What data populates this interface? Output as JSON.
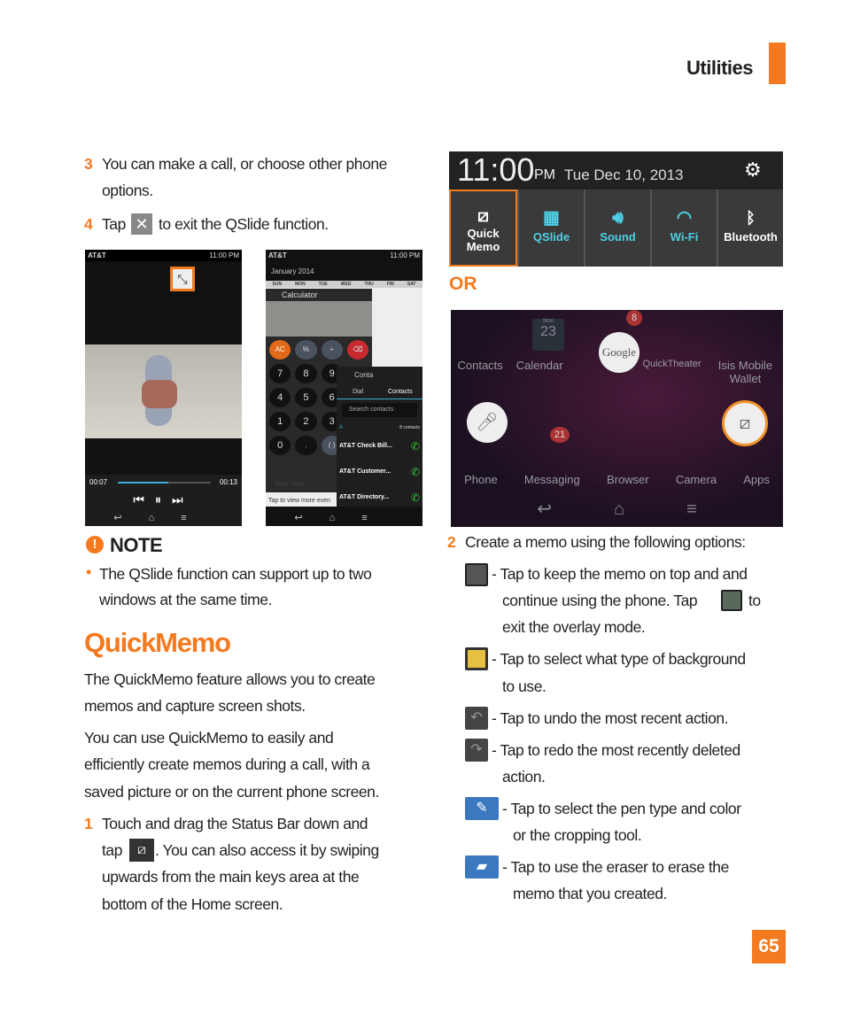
{
  "header": {
    "section": "Utilities",
    "accent": "#f47a20"
  },
  "page_number": "65",
  "step3": {
    "num": "3",
    "lines": [
      "You can make a call, or choose other phone",
      "options."
    ]
  },
  "step4": {
    "num": "4",
    "before": "Tap",
    "after": "to exit the QSlide function.",
    "icon": "close-x-icon"
  },
  "shot_video": {
    "carrier": "AT&T",
    "time": "11:00 PM",
    "elapsed": "00:07",
    "total": "00:13",
    "progress": 0.54
  },
  "shot_multi": {
    "carrier": "AT&T",
    "time": "11:00 PM",
    "month": "January 2014",
    "days": [
      "SUN",
      "MON",
      "TUE",
      "WED",
      "THU",
      "FRI",
      "SAT"
    ],
    "calc_title": "Calculator",
    "keys": [
      "AC",
      "%",
      "÷",
      "⌫",
      "7",
      "8",
      "9",
      "4",
      "5",
      "6",
      "1",
      "2",
      "3",
      "0",
      ".",
      "( )"
    ],
    "contacts_title": "Conta",
    "tabs": [
      "Dial",
      "Contacts"
    ],
    "search": "Search contacts",
    "section": "A",
    "count": "8 contacts",
    "contacts": [
      "AT&T Check Bill...",
      "AT&T Customer...",
      "AT&T Directory..."
    ],
    "city": "New York",
    "more": "Tap to view more even"
  },
  "note": {
    "title": "NOTE",
    "bullet": "The QSlide function can support up to two windows at the same time.",
    "lines": [
      "The QSlide function can support up to two",
      "windows at the same time."
    ]
  },
  "quickmemo": {
    "title": "QuickMemo",
    "p1": [
      "The QuickMemo feature allows you to create",
      "memos and capture screen shots."
    ],
    "p2": [
      "You can use QuickMemo to easily and",
      "efficiently create memos during a call, with a",
      "saved picture or on the current phone screen."
    ],
    "step1": {
      "num": "1",
      "lines": [
        "Touch and drag the Status Bar down and",
        "tap",
        ". You can also access it by swiping",
        "upwards from the main keys area at the",
        "bottom of the Home screen."
      ]
    }
  },
  "status_shot": {
    "time": "11:00",
    "ampm": "PM",
    "date": "Tue Dec 10, 2013",
    "tiles": [
      "Quick Memo",
      "QSlide",
      "Sound",
      "Wi-Fi",
      "Bluetooth"
    ]
  },
  "or_label": "OR",
  "home_shot": {
    "apps_top": [
      "Contacts",
      "Calendar",
      "",
      "QuickTheater",
      "Isis Mobile Wallet"
    ],
    "apps_bottom": [
      "Phone",
      "Messaging",
      "Browser",
      "Camera",
      "Apps"
    ],
    "cal_day": "Mon",
    "cal_date": "23",
    "badge_email": "8",
    "badge_msg": "21",
    "google": "Google"
  },
  "step2": {
    "num": "2",
    "text": "Create a memo using the following options:",
    "options": [
      {
        "icon": "overlay-icon",
        "lines": [
          "- Tap to keep the memo on top and and",
          "continue using the phone. Tap",
          "to",
          "exit the overlay mode."
        ]
      },
      {
        "icon": "background-icon",
        "lines": [
          "- Tap to select what type of background",
          "to use."
        ]
      },
      {
        "icon": "undo-icon",
        "lines": [
          "- Tap to undo the most recent action."
        ]
      },
      {
        "icon": "redo-icon",
        "lines": [
          "- Tap to redo the most recently deleted",
          "action."
        ]
      },
      {
        "icon": "pen-icon",
        "lines": [
          "- Tap to select the pen type and color",
          "or the cropping tool."
        ]
      },
      {
        "icon": "eraser-icon",
        "lines": [
          "- Tap to use the eraser to erase the",
          "memo that you created."
        ]
      }
    ]
  }
}
